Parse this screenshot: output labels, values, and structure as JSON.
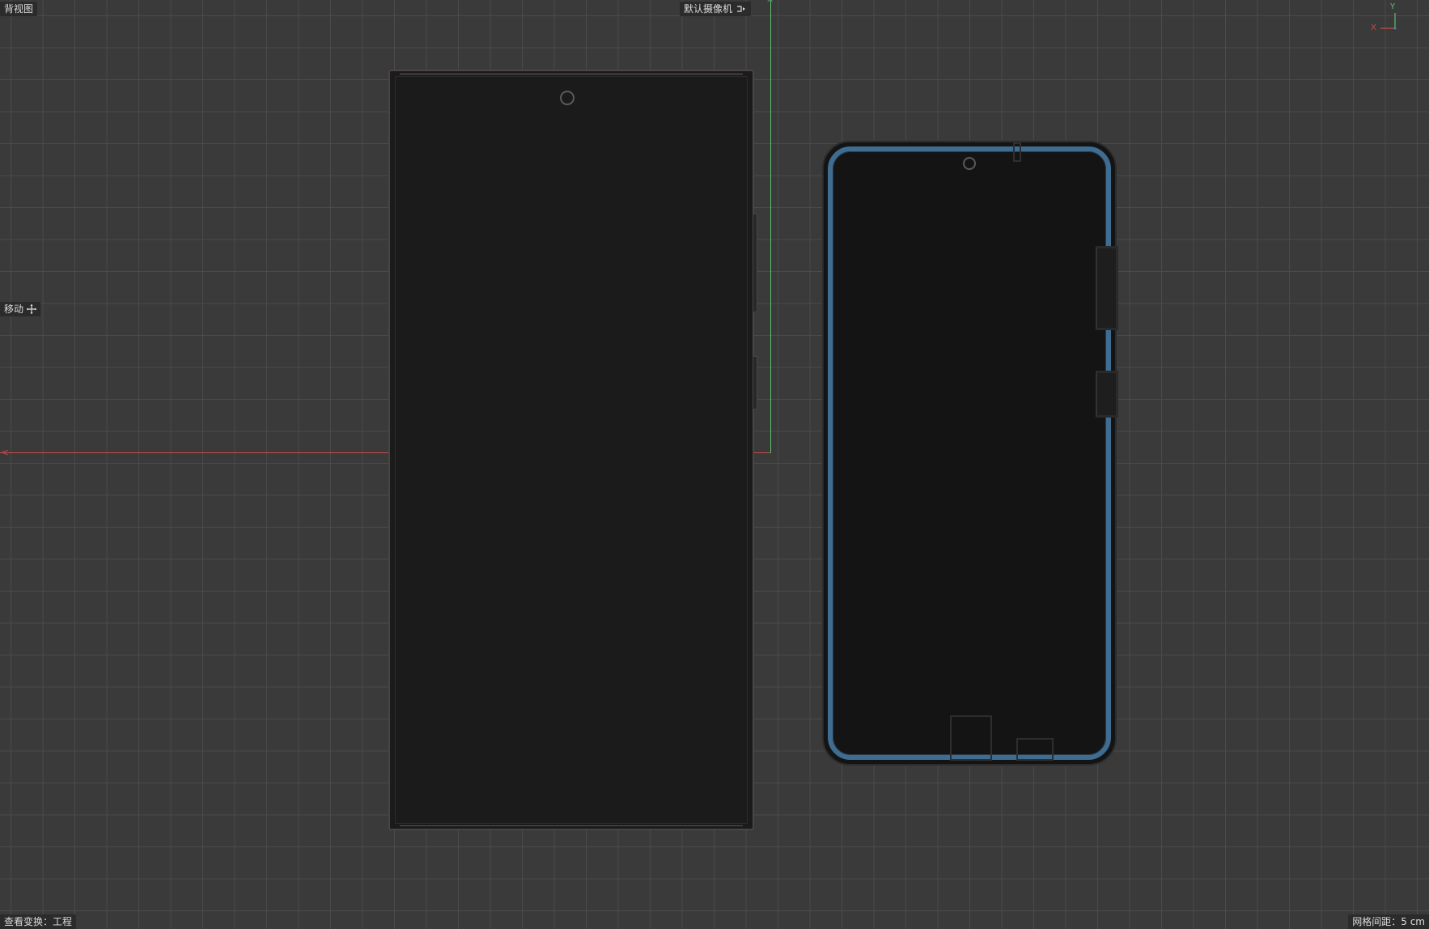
{
  "viewport": {
    "view_label": "背视图",
    "camera_label": "默认摄像机",
    "camera_icon": "camera-icon",
    "move_label": "移动",
    "move_icon": "move-icon",
    "view_transform_label": "查看变换：工程",
    "grid_spacing_label": "网格间距：5 cm"
  },
  "gizmo": {
    "x_label": "X",
    "y_label": "Y"
  },
  "colors": {
    "background": "#3a3a3a",
    "grid": "#4b4b4b",
    "x_axis": "#c44a4a",
    "y_axis": "#5fbf6c",
    "selected_outline": "#3f6d92"
  }
}
